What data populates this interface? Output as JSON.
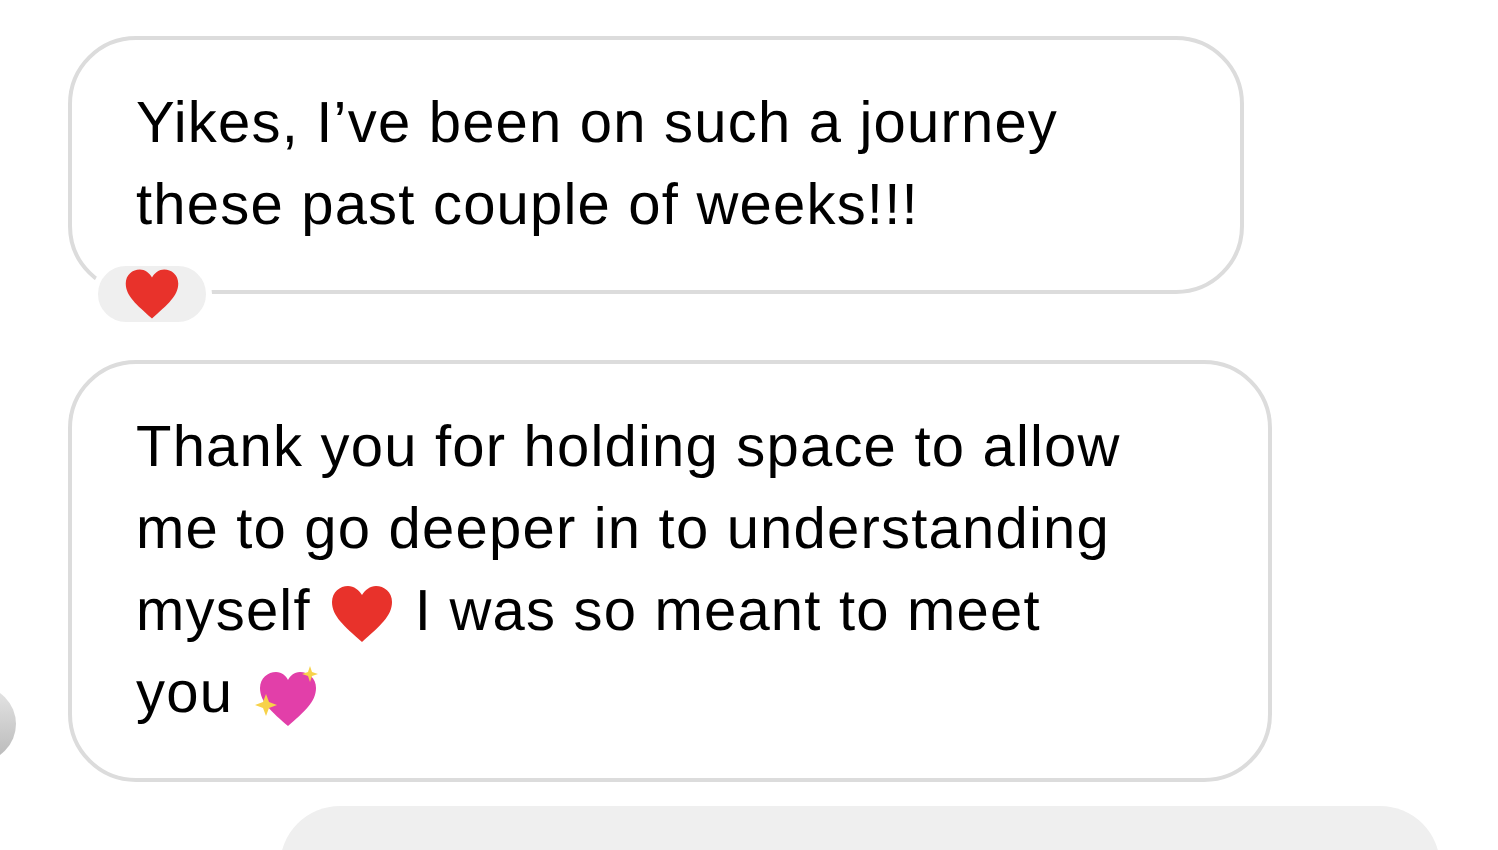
{
  "messages": [
    {
      "kind": "incoming",
      "lines": [
        [
          {
            "kind": "text",
            "text": "Yikes, I’ve been on such a journey"
          }
        ],
        [
          {
            "kind": "text",
            "text": "these past couple of weeks!!!"
          }
        ]
      ],
      "reaction": {
        "kind": "heart"
      },
      "avatar": false
    },
    {
      "kind": "incoming",
      "lines": [
        [
          {
            "kind": "text",
            "text": "Thank you for holding space to allow"
          }
        ],
        [
          {
            "kind": "text",
            "text": "me to go deeper in to understanding"
          }
        ],
        [
          {
            "kind": "text",
            "text": "myself"
          },
          {
            "kind": "heart"
          },
          {
            "kind": "text",
            "text": "I was so meant to meet"
          }
        ],
        [
          {
            "kind": "text",
            "text": "you"
          },
          {
            "kind": "sparkle-heart"
          }
        ]
      ],
      "avatar": true
    },
    {
      "kind": "outgoing"
    }
  ]
}
